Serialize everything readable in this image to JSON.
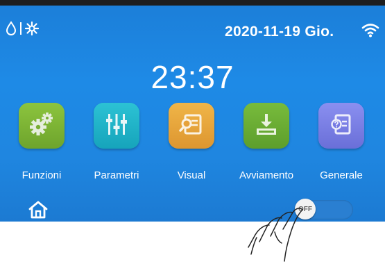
{
  "status": {
    "date": "2020-11-19 Gio.",
    "icons": [
      "water-drop-icon",
      "snowflake-icon",
      "wifi-icon"
    ]
  },
  "clock": {
    "time": "23:37"
  },
  "menu": {
    "items": [
      {
        "label": "Funzioni",
        "icon": "gears-icon",
        "color": "#7fb836"
      },
      {
        "label": "Parametri",
        "icon": "sliders-icon",
        "color": "#1fb5c8"
      },
      {
        "label": "Visual",
        "icon": "document-search-icon",
        "color": "#e8a23a"
      },
      {
        "label": "Avviamento",
        "icon": "download-icon",
        "color": "#6aae36"
      },
      {
        "label": "Generale",
        "icon": "document-question-icon",
        "color": "#7b7fe0"
      }
    ]
  },
  "footer": {
    "home_icon": "home-icon",
    "power_toggle": {
      "state_label": "OFF",
      "on": false
    }
  }
}
